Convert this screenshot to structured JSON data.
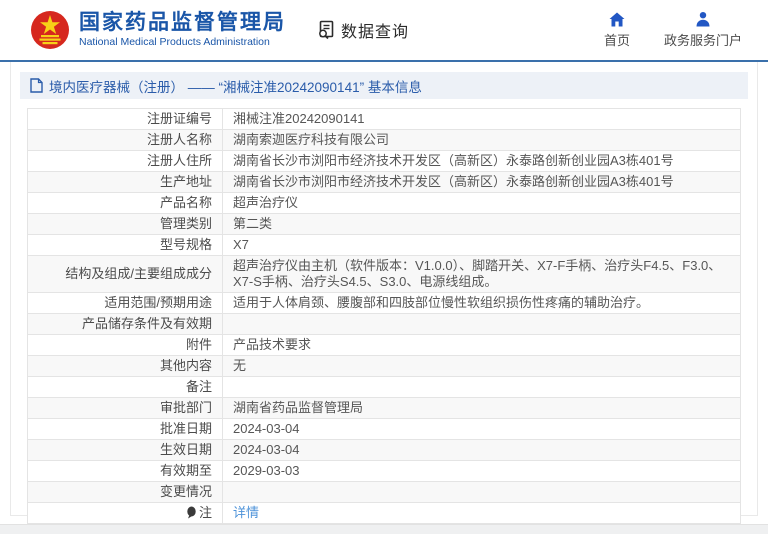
{
  "header": {
    "org_name_cn": "国家药品监督管理局",
    "org_name_en": "National Medical Products Administration",
    "data_query_label": "数据查询",
    "nav": {
      "home_label": "首页",
      "portal_label": "政务服务门户"
    }
  },
  "breadcrumb": {
    "text": "境内医疗器械（注册） —— “湘械注准20242090141” 基本信息"
  },
  "colors": {
    "accent_blue": "#1a56a8",
    "link_blue": "#4e93d9",
    "emblem_red": "#d6281e",
    "emblem_gold": "#f7d117"
  },
  "table": {
    "rows": [
      {
        "label": "注册证编号",
        "value": "湘械注准20242090141",
        "value_type": "text"
      },
      {
        "label": "注册人名称",
        "value": "湖南索迦医疗科技有限公司",
        "value_type": "text"
      },
      {
        "label": "注册人住所",
        "value": "湖南省长沙市浏阳市经济技术开发区（高新区）永泰路创新创业园A3栋401号",
        "value_type": "text"
      },
      {
        "label": "生产地址",
        "value": "湖南省长沙市浏阳市经济技术开发区（高新区）永泰路创新创业园A3栋401号",
        "value_type": "text"
      },
      {
        "label": "产品名称",
        "value": "超声治疗仪",
        "value_type": "text"
      },
      {
        "label": "管理类别",
        "value": "第二类",
        "value_type": "text"
      },
      {
        "label": "型号规格",
        "value": "X7",
        "value_type": "text"
      },
      {
        "label": "结构及组成/主要组成成分",
        "value": "超声治疗仪由主机（软件版本：V1.0.0）、脚踏开关、X7-F手柄、治疗头F4.5、F3.0、X7-S手柄、治疗头S4.5、S3.0、电源线组成。",
        "value_type": "text"
      },
      {
        "label": "适用范围/预期用途",
        "value": "适用于人体肩颈、腰腹部和四肢部位慢性软组织损伤性疼痛的辅助治疗。",
        "value_type": "text"
      },
      {
        "label": "产品储存条件及有效期",
        "value": "",
        "value_type": "empty"
      },
      {
        "label": "附件",
        "value": "产品技术要求",
        "value_type": "text"
      },
      {
        "label": "其他内容",
        "value": "无",
        "value_type": "text"
      },
      {
        "label": "备注",
        "value": "",
        "value_type": "empty"
      },
      {
        "label": "审批部门",
        "value": "湖南省药品监督管理局",
        "value_type": "text"
      },
      {
        "label": "批准日期",
        "value": "2024-03-04",
        "value_type": "text"
      },
      {
        "label": "生效日期",
        "value": "2024-03-04",
        "value_type": "text"
      },
      {
        "label": "有效期至",
        "value": "2029-03-03",
        "value_type": "text"
      },
      {
        "label": "变更情况",
        "value": "",
        "value_type": "empty"
      },
      {
        "label": "注",
        "value": "详情",
        "value_type": "link",
        "label_icon": "note-icon"
      }
    ]
  }
}
